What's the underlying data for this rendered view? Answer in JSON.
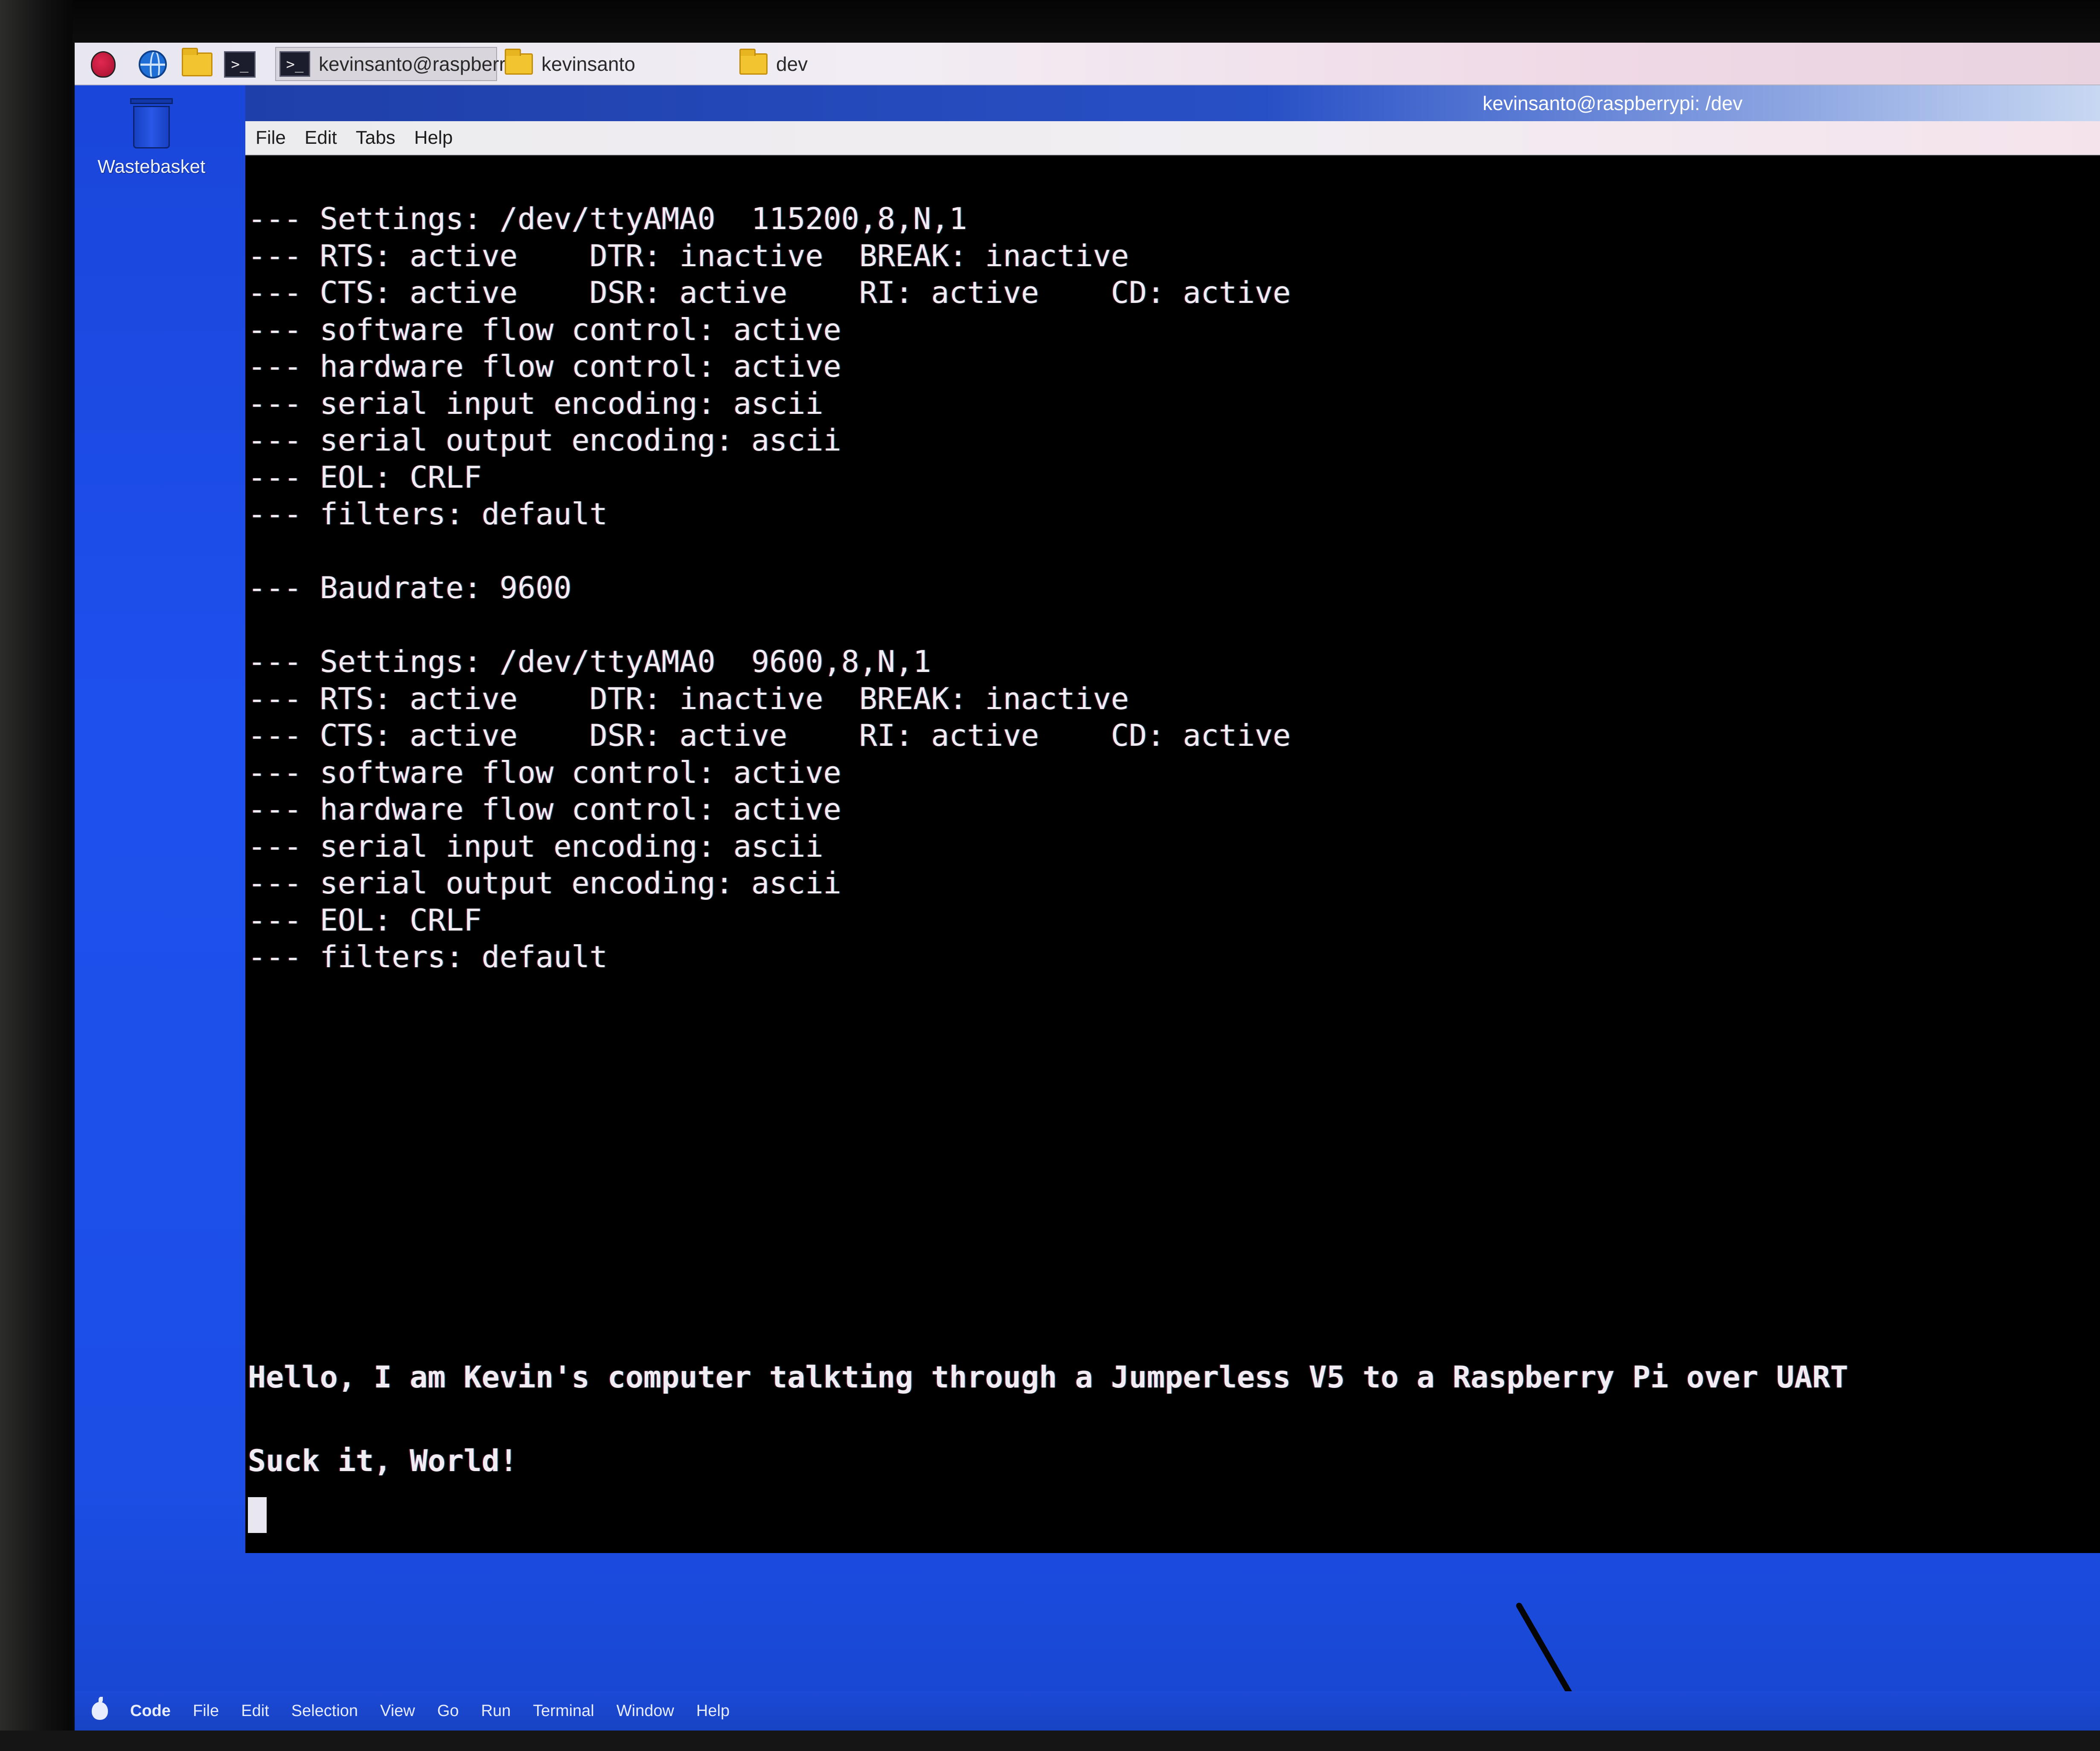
{
  "panel": {
    "tasks": [
      {
        "label": "kevinsanto@raspberr...",
        "icon": "terminal-icon"
      },
      {
        "label": "kevinsanto",
        "icon": "folder-icon"
      },
      {
        "label": "dev",
        "icon": "folder-icon"
      }
    ]
  },
  "desktop": {
    "wastebasket_label": "Wastebasket"
  },
  "terminal": {
    "title": "kevinsanto@raspberrypi: /dev",
    "menu": [
      "File",
      "Edit",
      "Tabs",
      "Help"
    ],
    "block1": [
      "--- Settings: /dev/ttyAMA0  115200,8,N,1",
      "--- RTS: active    DTR: inactive  BREAK: inactive",
      "--- CTS: active    DSR: active    RI: active    CD: active",
      "--- software flow control: active",
      "--- hardware flow control: active",
      "--- serial input encoding: ascii",
      "--- serial output encoding: ascii",
      "--- EOL: CRLF",
      "--- filters: default"
    ],
    "baudrate_line": "--- Baudrate: 9600",
    "block2": [
      "--- Settings: /dev/ttyAMA0  9600,8,N,1",
      "--- RTS: active    DTR: inactive  BREAK: inactive",
      "--- CTS: active    DSR: active    RI: active    CD: active",
      "--- software flow control: active",
      "--- hardware flow control: active",
      "--- serial input encoding: ascii",
      "--- serial output encoding: ascii",
      "--- EOL: CRLF",
      "--- filters: default"
    ],
    "message1": "Hello, I am Kevin's computer talkting through a Jumperless V5 to a Raspberry Pi over UART",
    "message2": "Suck it, World!"
  },
  "mac_menu": [
    "Code",
    "File",
    "Edit",
    "Selection",
    "View",
    "Go",
    "Run",
    "Terminal",
    "Window",
    "Help"
  ],
  "colors": {
    "desktop_blue": "#1e50ee",
    "terminal_bg": "#000000",
    "terminal_text": "#f1ecf2"
  }
}
